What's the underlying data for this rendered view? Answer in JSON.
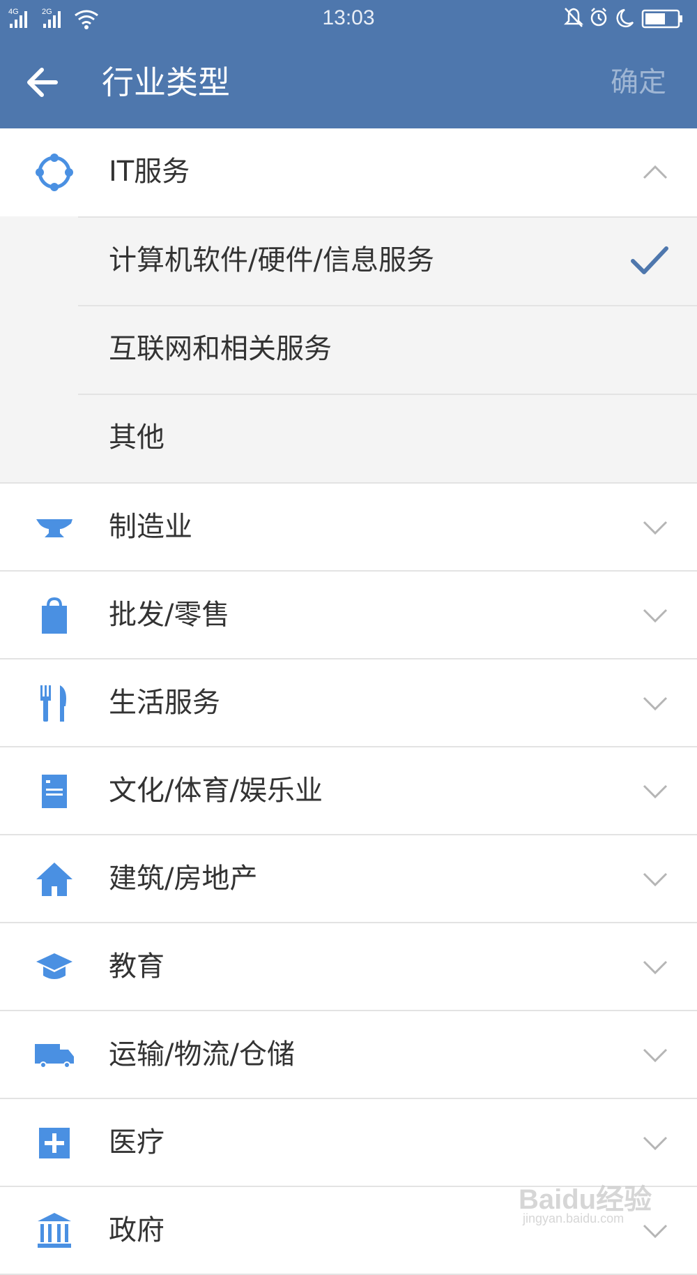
{
  "status_bar": {
    "network_1": "4G",
    "network_2": "2G",
    "time": "13:03",
    "icons": [
      "signal-icon",
      "signal-icon",
      "wifi-icon",
      "mute-icon",
      "alarm-icon",
      "moon-icon",
      "battery-icon"
    ]
  },
  "app_bar": {
    "title": "行业类型",
    "confirm_label": "确定",
    "back_icon": "arrow-left-icon"
  },
  "colors": {
    "primary": "#4e77ad",
    "icon_blue": "#4a90e2",
    "check": "#4e77ad",
    "sub_bg": "#f4f4f4"
  },
  "categories": [
    {
      "label": "IT服务",
      "icon": "network-icon",
      "expanded": true,
      "children": [
        {
          "label": "计算机软件/硬件/信息服务",
          "selected": true
        },
        {
          "label": "互联网和相关服务",
          "selected": false
        },
        {
          "label": "其他",
          "selected": false
        }
      ]
    },
    {
      "label": "制造业",
      "icon": "anvil-icon",
      "expanded": false
    },
    {
      "label": "批发/零售",
      "icon": "shopping-bag-icon",
      "expanded": false
    },
    {
      "label": "生活服务",
      "icon": "fork-knife-icon",
      "expanded": false
    },
    {
      "label": "文化/体育/娱乐业",
      "icon": "document-icon",
      "expanded": false
    },
    {
      "label": "建筑/房地产",
      "icon": "house-icon",
      "expanded": false
    },
    {
      "label": "教育",
      "icon": "graduation-cap-icon",
      "expanded": false
    },
    {
      "label": "运输/物流/仓储",
      "icon": "truck-icon",
      "expanded": false
    },
    {
      "label": "医疗",
      "icon": "medical-cross-icon",
      "expanded": false
    },
    {
      "label": "政府",
      "icon": "government-building-icon",
      "expanded": false
    }
  ],
  "watermark": {
    "text": "Baidu经验",
    "url": "jingyan.baidu.com"
  }
}
